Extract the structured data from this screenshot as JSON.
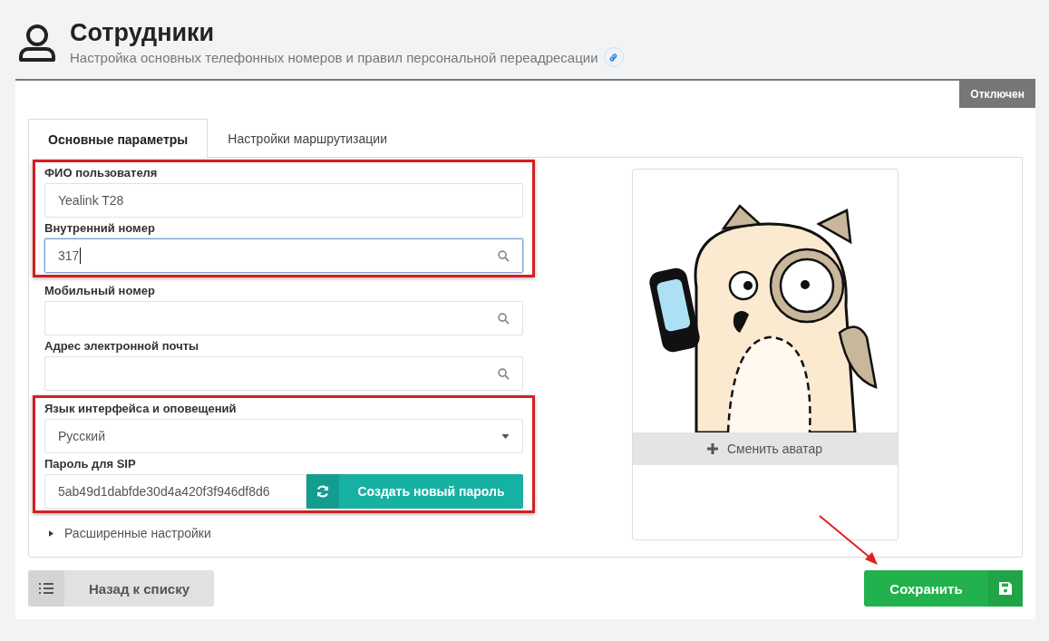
{
  "header": {
    "title": "Сотрудники",
    "subtitle": "Настройка основных телефонных номеров и правил персональной переадресации"
  },
  "status_badge": "Отключен",
  "tabs": [
    {
      "label": "Основные параметры",
      "selected": true
    },
    {
      "label": "Настройки маршрутизации",
      "selected": false
    }
  ],
  "field_groups": [
    {
      "highlighted": true,
      "fields": [
        {
          "label": "ФИО пользователя",
          "kind": "text",
          "value": "Yealink T28",
          "focused": false
        },
        {
          "label": "Внутренний номер",
          "kind": "search",
          "value": "317",
          "focused": true
        }
      ]
    },
    {
      "highlighted": false,
      "fields": [
        {
          "label": "Мобильный номер",
          "kind": "search",
          "focused": false
        },
        {
          "label": "Адрес электронной почты",
          "kind": "search",
          "focused": false
        }
      ]
    },
    {
      "highlighted": true,
      "fields": [
        {
          "label": "Язык интерфейса и оповещений",
          "kind": "select",
          "value": "Русский",
          "focused": false
        },
        {
          "label": "Пароль для SIP",
          "kind": "password",
          "value": "5ab49d1dabfde30d4a420f3f946df8d6",
          "action": "Создать новый пароль"
        }
      ]
    }
  ],
  "advanced": {
    "label": "Расширенные настройки",
    "expanded": false
  },
  "avatar": {
    "action": "Сменить аватар"
  },
  "buttons": {
    "back": "Назад к списку",
    "save": "Сохранить"
  }
}
